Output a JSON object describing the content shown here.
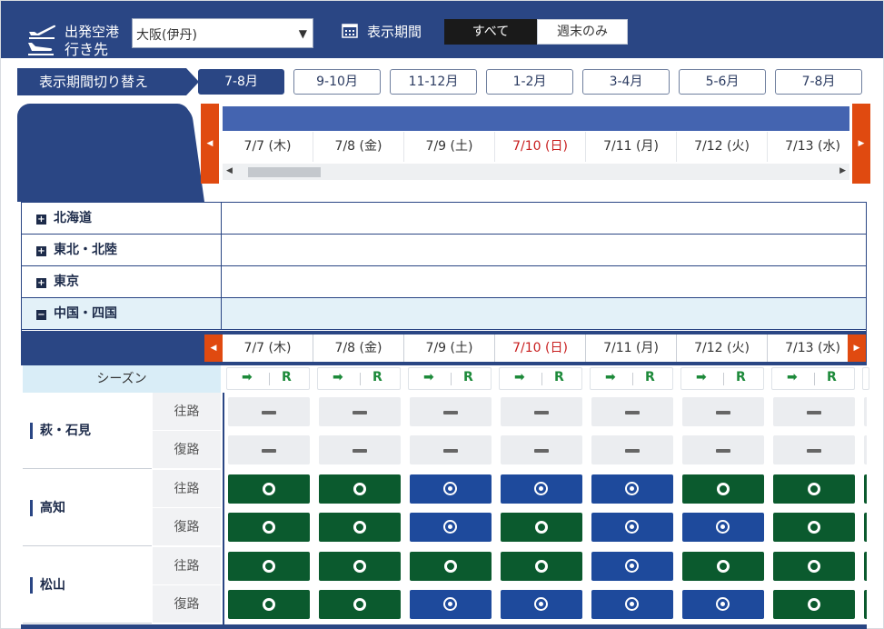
{
  "topbar": {
    "origin_label": "出発空港",
    "origin_value": "大阪(伊丹)",
    "period_label": "表示期間",
    "seg_all": "すべて",
    "seg_weekend": "週末のみ"
  },
  "period_switch": {
    "label": "表示期間切り替え",
    "buttons": [
      "7-8月",
      "9-10月",
      "11-12月",
      "1-2月",
      "3-4月",
      "5-6月",
      "7-8月"
    ],
    "active_index": 0
  },
  "destination_tab": "行き先",
  "dates": [
    {
      "label": "7/7 (木)",
      "sunday": false
    },
    {
      "label": "7/8 (金)",
      "sunday": false
    },
    {
      "label": "7/9 (土)",
      "sunday": false
    },
    {
      "label": "7/10 (日)",
      "sunday": true
    },
    {
      "label": "7/11 (月)",
      "sunday": false
    },
    {
      "label": "7/12 (火)",
      "sunday": false
    },
    {
      "label": "7/13 (水)",
      "sunday": false
    }
  ],
  "regions": [
    {
      "name": "北海道",
      "toggle": "+",
      "expanded": false
    },
    {
      "name": "東北・北陸",
      "toggle": "+",
      "expanded": false
    },
    {
      "name": "東京",
      "toggle": "+",
      "expanded": false
    },
    {
      "name": "中国・四国",
      "toggle": "−",
      "expanded": true
    }
  ],
  "season": {
    "label": "シーズン",
    "arrow": "➡",
    "r": "R"
  },
  "routes": [
    {
      "name": "萩・石見",
      "rows": [
        {
          "dir": "往路",
          "cells": [
            "dash",
            "dash",
            "dash",
            "dash",
            "dash",
            "dash",
            "dash"
          ]
        },
        {
          "dir": "復路",
          "cells": [
            "dash",
            "dash",
            "dash",
            "dash",
            "dash",
            "dash",
            "dash"
          ]
        }
      ]
    },
    {
      "name": "高知",
      "rows": [
        {
          "dir": "往路",
          "cells": [
            "green",
            "green",
            "blue",
            "blue",
            "blue",
            "green",
            "green"
          ]
        },
        {
          "dir": "復路",
          "cells": [
            "green",
            "green",
            "blue",
            "green",
            "blue",
            "blue",
            "green"
          ]
        }
      ]
    },
    {
      "name": "松山",
      "rows": [
        {
          "dir": "往路",
          "cells": [
            "green",
            "green",
            "green",
            "green",
            "blue",
            "green",
            "green"
          ]
        },
        {
          "dir": "復路",
          "cells": [
            "green",
            "green",
            "blue",
            "blue",
            "blue",
            "blue",
            "green"
          ]
        }
      ]
    }
  ],
  "colors": {
    "navy": "#2a4684",
    "green": "#0b5a2e",
    "blue": "#1e4a9c",
    "arrow_orange": "#e04a10",
    "sunday_red": "#c81e1e"
  }
}
